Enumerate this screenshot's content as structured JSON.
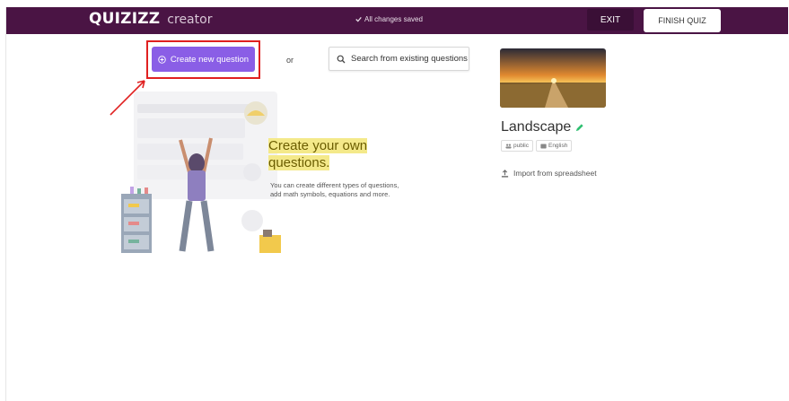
{
  "app": {
    "logo": "QUIZIZZ",
    "subtitle": "creator",
    "save_status": "All changes saved",
    "exit_label": "EXIT",
    "finish_label": "FINISH QUIZ"
  },
  "actions": {
    "create_label": "Create new question",
    "or_label": "or",
    "search_label": "Search from existing questions"
  },
  "empty_state": {
    "heading_line1": "Create your own",
    "heading_line2": "questions.",
    "desc_line1": "You can create different types of questions,",
    "desc_line2": "add math symbols, equations and more."
  },
  "quiz": {
    "name": "Landscape",
    "visibility": "public",
    "language": "English",
    "import_label": "Import from spreadsheet"
  },
  "colors": {
    "topbar": "#4a1444",
    "create_button": "#8a5ee6",
    "highlight": "#e02020",
    "heading_highlight": "#f4e98a"
  }
}
